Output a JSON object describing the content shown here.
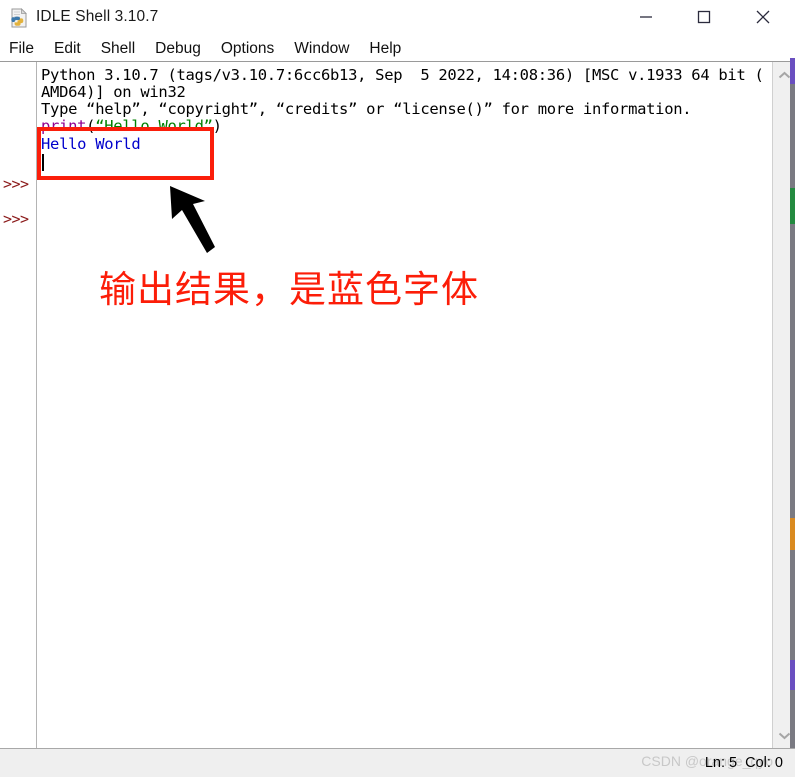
{
  "window": {
    "title": "IDLE Shell 3.10.7",
    "icon": "python-file-icon",
    "controls": {
      "minimize": "–",
      "maximize": "□",
      "close": "✕"
    }
  },
  "menubar": {
    "items": [
      {
        "label": "File"
      },
      {
        "label": "Edit"
      },
      {
        "label": "Shell"
      },
      {
        "label": "Debug"
      },
      {
        "label": "Options"
      },
      {
        "label": "Window"
      },
      {
        "label": "Help"
      }
    ]
  },
  "shell": {
    "prompts": [
      ">>>",
      ">>>"
    ],
    "banner": [
      "Python 3.10.7 (tags/v3.10.7:6cc6b13, Sep  5 2022, 14:08:36) [MSC v.1933 64 bit (",
      "AMD64)] on win32",
      "Type “help”, “copyright”, “credits” or “license()” for more information."
    ],
    "command": {
      "func": "print",
      "open_paren": "(",
      "string": "“Hello World”",
      "close_paren": ")"
    },
    "output": "Hello World",
    "scrollbar": {
      "up_arrow": "⌃",
      "down_arrow": "⌄"
    }
  },
  "statusbar": {
    "position": "Ln: 5  Col: 0",
    "watermark": "CSDN @orange_qyo"
  },
  "annotation": {
    "text": "输出结果，是蓝色字体",
    "box_color": "#fb1e0a",
    "text_color": "#fc1d08",
    "arrow": "pointer-arrow-up-left"
  },
  "colors": {
    "prompt": "#8b1a1a",
    "function": "#900090",
    "string": "#008000",
    "output": "#0000cc",
    "plain": "#000000"
  }
}
